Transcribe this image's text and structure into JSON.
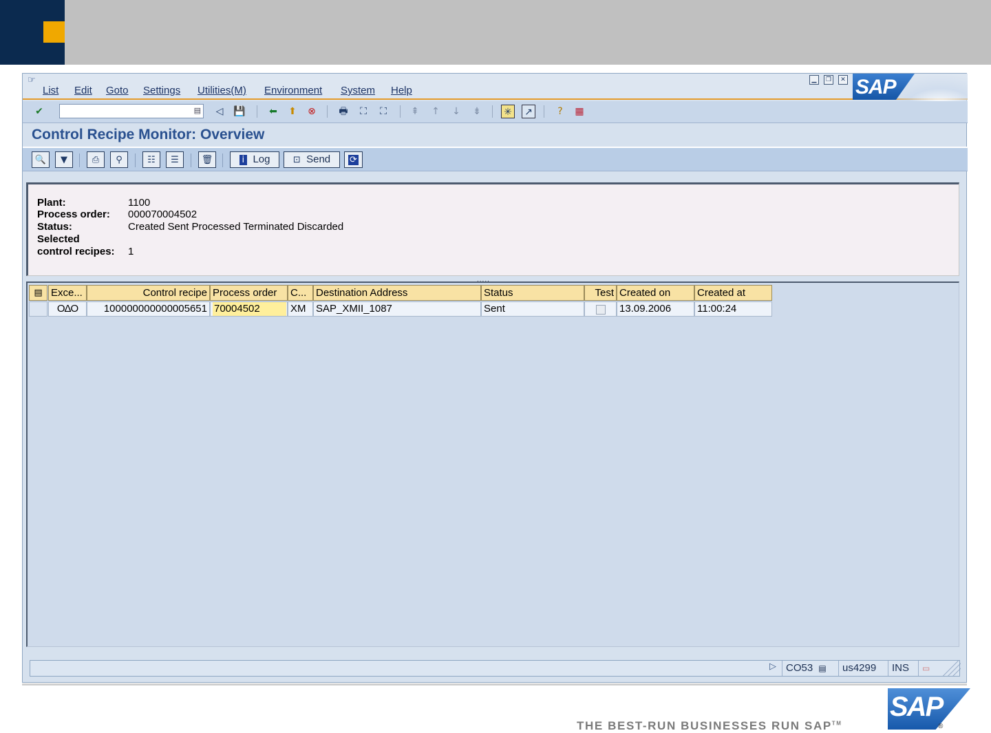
{
  "menu": {
    "items": [
      "List",
      "Edit",
      "Goto",
      "Settings",
      "Utilities(M)",
      "Environment",
      "System",
      "Help"
    ]
  },
  "brand": {
    "logo": "SAP",
    "tagline": "THE BEST-RUN BUSINESSES RUN SAP",
    "tm": "TM",
    "reg": "®"
  },
  "command_field": {
    "value": ""
  },
  "title": "Control Recipe Monitor: Overview",
  "app_toolbar": {
    "log_label": "Log",
    "send_label": "Send"
  },
  "header": {
    "plant_label": "Plant:",
    "plant": "1100",
    "order_label": "Process order:",
    "order": "000070004502",
    "status_label": "Status:",
    "status": "Created Sent Processed Terminated Discarded",
    "selected_label": "Selected",
    "count_label": "control recipes:",
    "count": "1"
  },
  "splitter": ".....",
  "table": {
    "columns": [
      "Exce...",
      "Control recipe",
      "Process order",
      "C...",
      "Destination Address",
      "Status",
      "Test",
      "Created on",
      "Created at"
    ],
    "rows": [
      {
        "exception": "OΔO",
        "control_recipe": "100000000000005651",
        "process_order": "70004502",
        "category": "XM",
        "destination": "SAP_XMII_1087",
        "status": "Sent",
        "test": false,
        "created_on": "13.09.2006",
        "created_at": "11:00:24"
      }
    ]
  },
  "statusbar": {
    "transaction": "CO53",
    "server": "us4299",
    "mode": "INS"
  },
  "colors": {
    "accent": "#e69b2a",
    "highlight": "#ffef9c",
    "title": "#29508f"
  }
}
